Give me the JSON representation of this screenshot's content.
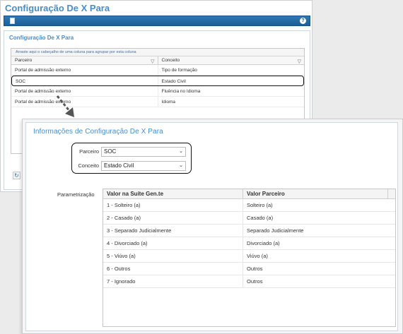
{
  "app": {
    "title": "Configuração De X Para"
  },
  "back_panel": {
    "title": "Configuração De X Para",
    "group_hint": "Arraste aqui o cabeçalho de uma coluna para agrupar por esta coluna",
    "columns": [
      "Parceiro",
      "Conceito"
    ],
    "rows": [
      [
        "Portal de admissão externo",
        "Tipo de formação"
      ],
      [
        "SOC",
        "Estado Civil"
      ],
      [
        "Portal de admissão externo",
        "Fluência no Idioma"
      ],
      [
        "Portal de admissão externo",
        "Idioma"
      ]
    ]
  },
  "dialog": {
    "title": "Informações de Configuração De X Para",
    "parceiro": {
      "label": "Parceiro",
      "value": "SOC"
    },
    "conceito": {
      "label": "Conceito",
      "value": "Estado Civil"
    },
    "param_label": "Parametrização",
    "table": {
      "columns": [
        "Valor na Suíte Gen.te",
        "Valor Parceiro"
      ],
      "rows": [
        [
          "1 - Solteiro (a)",
          "Solteiro (a)"
        ],
        [
          "2 - Casado (a)",
          "Casado (a)"
        ],
        [
          "3 - Separado Judicialmente",
          "Separado Judicialmente"
        ],
        [
          "4 - Divorciado (a)",
          "Divorciado (a)"
        ],
        [
          "5 - Viúvo (a)",
          "Viúvo (a)"
        ],
        [
          "6 - Outros",
          "Outros"
        ],
        [
          "7 - Ignorado",
          "Outros"
        ]
      ]
    }
  },
  "icons": {
    "toolbar_left": "document-icon",
    "toolbar_right": "help-icon",
    "grid_filter": "filter-icon",
    "refresh": "refresh-icon",
    "select_chevron": "chevron-down-icon"
  },
  "colors": {
    "accent": "#4a8cc4",
    "toolbar": "#1d5f96",
    "required": "#e0302a"
  }
}
